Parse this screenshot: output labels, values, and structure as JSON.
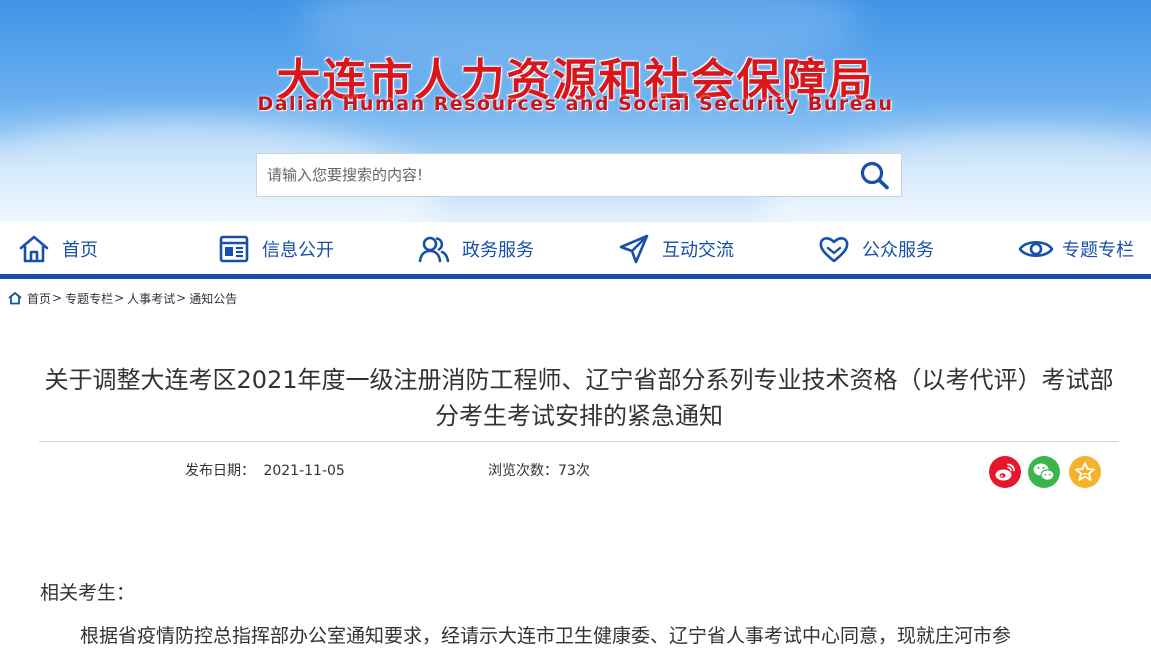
{
  "header": {
    "title": "大连市人力资源和社会保障局",
    "subtitle": "Dalian Human Resources and Social Security Bureau"
  },
  "search": {
    "placeholder": "请输入您要搜索的内容!",
    "value": ""
  },
  "nav": {
    "items": [
      {
        "label": "首页",
        "icon": "home-icon"
      },
      {
        "label": "信息公开",
        "icon": "info-list-icon"
      },
      {
        "label": "政务服务",
        "icon": "users-icon"
      },
      {
        "label": "互动交流",
        "icon": "send-icon"
      },
      {
        "label": "公众服务",
        "icon": "heart-icon"
      },
      {
        "label": "专题专栏",
        "icon": "eye-icon"
      }
    ]
  },
  "breadcrumb": {
    "items": [
      "首页",
      "专题专栏",
      "人事考试",
      "通知公告"
    ],
    "separator": ">"
  },
  "article": {
    "title": "关于调整大连考区2021年度一级注册消防工程师、辽宁省部分系列专业技术资格（以考代评）考试部分考生考试安排的紧急通知",
    "publish_label": "发布日期：",
    "publish_date": "2021-11-05",
    "views_label": "浏览次数：",
    "views_value": "73次",
    "salutation": "相关考生：",
    "paragraph": "根据省疫情防控总指挥部办公室通知要求，经请示大连市卫生健康委、辽宁省人事考试中心同意，现就庄河市参"
  },
  "share": {
    "items": [
      {
        "name": "weibo",
        "icon": "weibo-icon",
        "color": "#e6162d"
      },
      {
        "name": "wechat",
        "icon": "wechat-icon",
        "color": "#3bb54a"
      },
      {
        "name": "favorite",
        "icon": "star-icon",
        "color": "#f5b22d"
      }
    ]
  },
  "colors": {
    "brand_red": "#d9161c",
    "nav_blue": "#1750a9",
    "text": "#333333"
  }
}
